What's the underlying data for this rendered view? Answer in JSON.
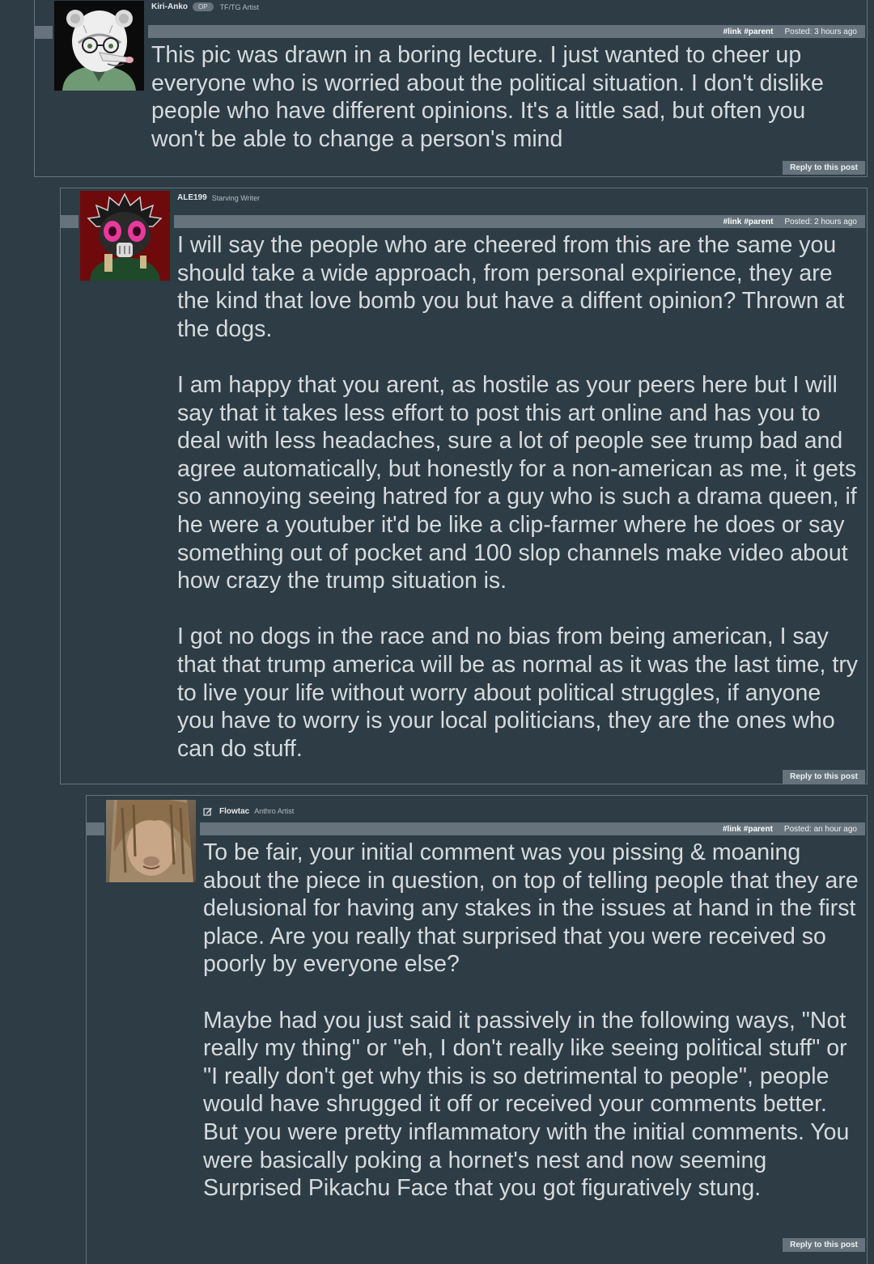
{
  "comments": [
    {
      "username": "Kiri-Anko",
      "badge": "OP",
      "user_title": "TF/TG Artist",
      "link_label": "#link",
      "parent_label": "#parent",
      "posted": "Posted: 3 hours ago",
      "avatar_icon": "opossum-avatar",
      "paragraphs": [
        "This pic was drawn in a boring lecture. I just wanted to cheer up everyone who is worried about the political situation. I don't dislike people who have different opinions. It's a little sad, but often you won't be able to change a person's mind"
      ],
      "reply_label": "Reply to this post"
    },
    {
      "username": "ALE199",
      "user_title": "Starving Writer",
      "link_label": "#link",
      "parent_label": "#parent",
      "posted": "Posted: 2 hours ago",
      "avatar_icon": "gasmask-avatar",
      "paragraphs": [
        "I will say the people who are cheered from this are the same you should take a wide approach, from personal expirience, they are the kind that love bomb you but have a diffent opinion? Thrown at the dogs.",
        "I am happy that you arent, as hostile as your peers here but I will say that it takes less effort to post this art online and has you to deal with less headaches, sure a lot of people see trump bad and agree automatically, but honestly for a non-american as me, it gets so annoying seeing hatred for a guy who is such a drama queen, if he were a youtuber it'd be like a clip-farmer where he does or say something out of pocket and 100 slop channels make video about how crazy the trump situation is.",
        "I got no dogs in the race and no bias from being american, I say that that trump america will be as normal as it was the last time, try to live your life without worry about political struggles, if anyone you have to worry is your local politicians, they are the ones who can do stuff."
      ],
      "reply_label": "Reply to this post"
    },
    {
      "username": "Flowtac",
      "user_title": "Anthro Artist",
      "link_label": "#link",
      "parent_label": "#parent",
      "posted": "Posted: an hour ago",
      "avatar_icon": "photo-avatar",
      "edit_icon": "edit-icon",
      "paragraphs": [
        "To be fair, your initial comment was you pissing & moaning about the piece in question, on top of telling people that they are delusional for having any stakes in the issues at hand in the first place. Are you really that surprised that you were received so poorly by everyone else?",
        "Maybe had you just said it passively in the following ways, \"Not really my thing\" or \"eh, I don't really like seeing political stuff\" or \"I really don't get why this is so detrimental to people\", people would have shrugged it off or received your comments better. But you were pretty inflammatory with the initial comments. You were basically poking a hornet's nest and now seeming Surprised Pikachu Face that you got figuratively stung."
      ],
      "reply_label": "Reply to this post"
    }
  ]
}
